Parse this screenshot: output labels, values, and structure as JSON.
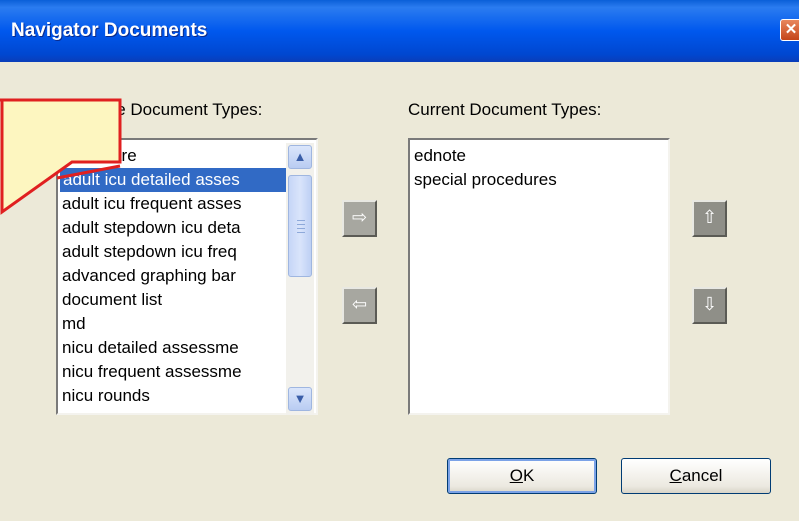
{
  "window": {
    "title": "Navigator Documents",
    "close_glyph": "✕"
  },
  "available": {
    "label": "Available Document Types:",
    "items": [
      "adult care",
      "adult icu detailed asses",
      "adult icu frequent asses",
      "adult stepdown icu deta",
      "adult stepdown icu freq",
      "advanced graphing bar",
      "document list",
      "md",
      "nicu detailed assessme",
      "nicu frequent assessme",
      "nicu rounds"
    ],
    "selected_index": 1
  },
  "current": {
    "label": "Current Document Types:",
    "items": [
      "ednote",
      "special procedures"
    ]
  },
  "icons": {
    "move_right": "arrow-right-icon",
    "move_left": "arrow-left-icon",
    "move_up": "arrow-up-icon",
    "move_down": "arrow-down-icon"
  },
  "buttons": {
    "ok": "OK",
    "cancel": "Cancel"
  },
  "colors": {
    "titlebar": "#0054e3",
    "selection": "#316ac5",
    "callout_fill": "#fdf6c0",
    "callout_border": "#e02020"
  }
}
